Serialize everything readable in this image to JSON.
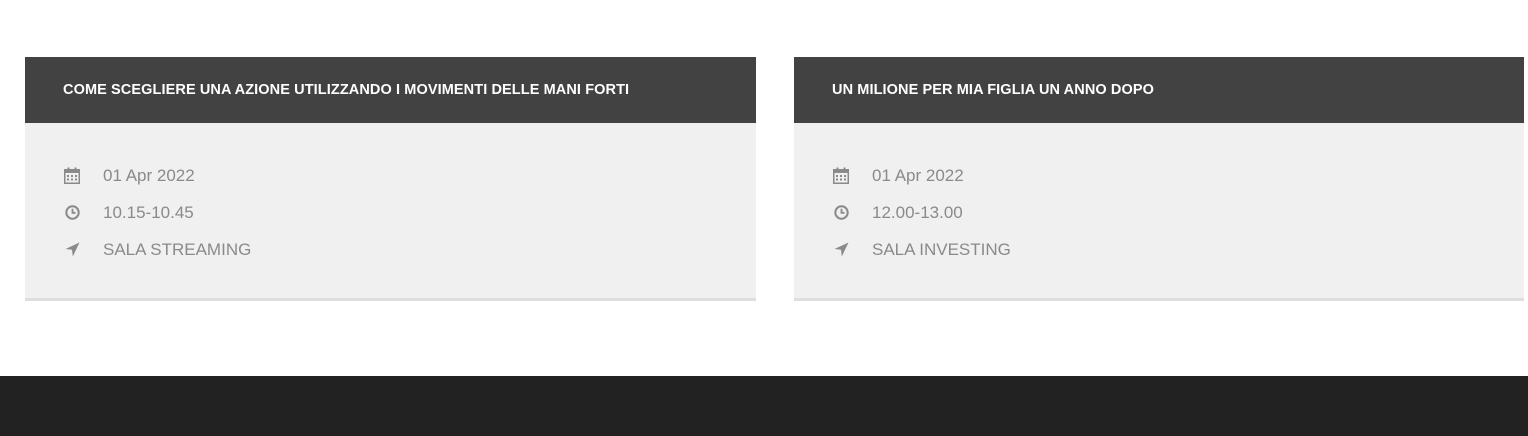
{
  "events": [
    {
      "title": "COME SCEGLIERE UNA AZIONE UTILIZZANDO I MOVIMENTI DELLE MANI FORTI",
      "date": "01 Apr 2022",
      "time": "10.15-10.45",
      "location": "SALA STREAMING",
      "icons": {
        "date": "calendar-icon",
        "time": "clock-icon",
        "location": "location-arrow-icon"
      }
    },
    {
      "title": "UN MILIONE PER MIA FIGLIA UN ANNO DOPO",
      "date": "01 Apr 2022",
      "time": "12.00-13.00",
      "location": "SALA INVESTING",
      "icons": {
        "date": "calendar-icon",
        "time": "clock-icon",
        "location": "location-arrow-icon"
      }
    }
  ],
  "colors": {
    "header_bg": "#424242",
    "card_bg": "#f0f0f0",
    "info_text": "#8a8a8a",
    "footer_bg": "#222222"
  }
}
